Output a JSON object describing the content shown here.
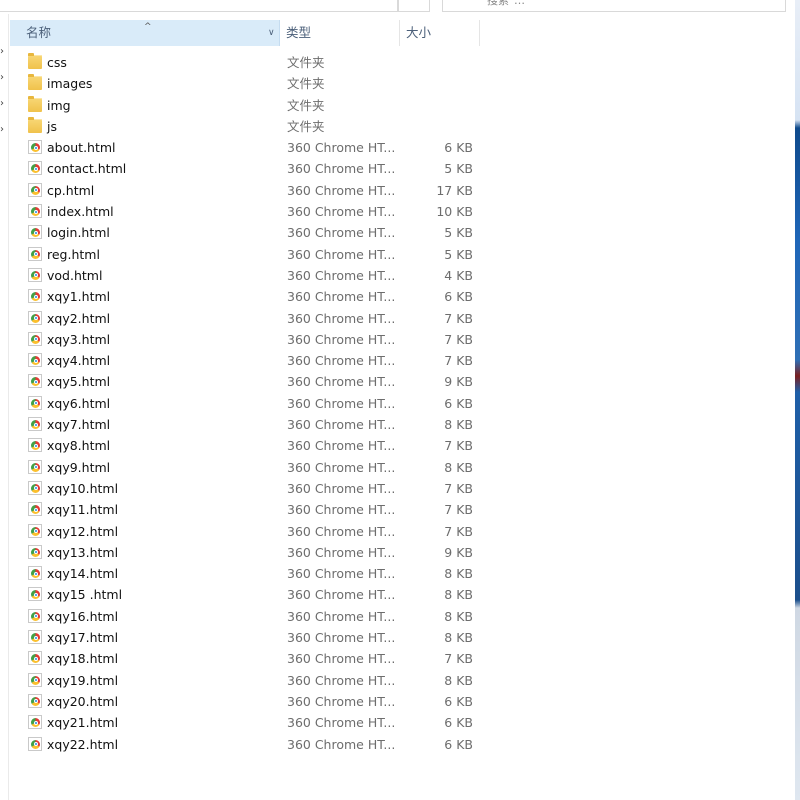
{
  "header": {
    "col_name": "名称",
    "col_type": "类型",
    "col_size": "大小",
    "sort_arrow": "^",
    "dropdown": "∨"
  },
  "topbar": {
    "breadcrumbs": [
      "…",
      "…",
      "…"
    ],
    "search_placeholder": "搜索\"…\""
  },
  "files": [
    {
      "name": "css",
      "type": "文件夹",
      "size": "",
      "icon": "folder-icon"
    },
    {
      "name": "images",
      "type": "文件夹",
      "size": "",
      "icon": "folder-icon"
    },
    {
      "name": "img",
      "type": "文件夹",
      "size": "",
      "icon": "folder-icon"
    },
    {
      "name": "js",
      "type": "文件夹",
      "size": "",
      "icon": "folder-icon"
    },
    {
      "name": "about.html",
      "type": "360 Chrome HT...",
      "size": "6 KB",
      "icon": "html-file-icon"
    },
    {
      "name": "contact.html",
      "type": "360 Chrome HT...",
      "size": "5 KB",
      "icon": "html-file-icon"
    },
    {
      "name": "cp.html",
      "type": "360 Chrome HT...",
      "size": "17 KB",
      "icon": "html-file-icon"
    },
    {
      "name": "index.html",
      "type": "360 Chrome HT...",
      "size": "10 KB",
      "icon": "html-file-icon"
    },
    {
      "name": "login.html",
      "type": "360 Chrome HT...",
      "size": "5 KB",
      "icon": "html-file-icon"
    },
    {
      "name": "reg.html",
      "type": "360 Chrome HT...",
      "size": "5 KB",
      "icon": "html-file-icon"
    },
    {
      "name": "vod.html",
      "type": "360 Chrome HT...",
      "size": "4 KB",
      "icon": "html-file-icon"
    },
    {
      "name": "xqy1.html",
      "type": "360 Chrome HT...",
      "size": "6 KB",
      "icon": "html-file-icon"
    },
    {
      "name": "xqy2.html",
      "type": "360 Chrome HT...",
      "size": "7 KB",
      "icon": "html-file-icon"
    },
    {
      "name": "xqy3.html",
      "type": "360 Chrome HT...",
      "size": "7 KB",
      "icon": "html-file-icon"
    },
    {
      "name": "xqy4.html",
      "type": "360 Chrome HT...",
      "size": "7 KB",
      "icon": "html-file-icon"
    },
    {
      "name": "xqy5.html",
      "type": "360 Chrome HT...",
      "size": "9 KB",
      "icon": "html-file-icon"
    },
    {
      "name": "xqy6.html",
      "type": "360 Chrome HT...",
      "size": "6 KB",
      "icon": "html-file-icon"
    },
    {
      "name": "xqy7.html",
      "type": "360 Chrome HT...",
      "size": "8 KB",
      "icon": "html-file-icon"
    },
    {
      "name": "xqy8.html",
      "type": "360 Chrome HT...",
      "size": "7 KB",
      "icon": "html-file-icon"
    },
    {
      "name": "xqy9.html",
      "type": "360 Chrome HT...",
      "size": "8 KB",
      "icon": "html-file-icon"
    },
    {
      "name": "xqy10.html",
      "type": "360 Chrome HT...",
      "size": "7 KB",
      "icon": "html-file-icon"
    },
    {
      "name": "xqy11.html",
      "type": "360 Chrome HT...",
      "size": "7 KB",
      "icon": "html-file-icon"
    },
    {
      "name": "xqy12.html",
      "type": "360 Chrome HT...",
      "size": "7 KB",
      "icon": "html-file-icon"
    },
    {
      "name": "xqy13.html",
      "type": "360 Chrome HT...",
      "size": "9 KB",
      "icon": "html-file-icon"
    },
    {
      "name": "xqy14.html",
      "type": "360 Chrome HT...",
      "size": "8 KB",
      "icon": "html-file-icon"
    },
    {
      "name": "xqy15 .html",
      "type": "360 Chrome HT...",
      "size": "8 KB",
      "icon": "html-file-icon"
    },
    {
      "name": "xqy16.html",
      "type": "360 Chrome HT...",
      "size": "8 KB",
      "icon": "html-file-icon"
    },
    {
      "name": "xqy17.html",
      "type": "360 Chrome HT...",
      "size": "8 KB",
      "icon": "html-file-icon"
    },
    {
      "name": "xqy18.html",
      "type": "360 Chrome HT...",
      "size": "7 KB",
      "icon": "html-file-icon"
    },
    {
      "name": "xqy19.html",
      "type": "360 Chrome HT...",
      "size": "8 KB",
      "icon": "html-file-icon"
    },
    {
      "name": "xqy20.html",
      "type": "360 Chrome HT...",
      "size": "6 KB",
      "icon": "html-file-icon"
    },
    {
      "name": "xqy21.html",
      "type": "360 Chrome HT...",
      "size": "6 KB",
      "icon": "html-file-icon"
    },
    {
      "name": "xqy22.html",
      "type": "360 Chrome HT...",
      "size": "6 KB",
      "icon": "html-file-icon"
    }
  ],
  "colors": {
    "header_selected_bg": "#d9ebf9",
    "header_text": "#4c607a",
    "folder": "#f0c24b",
    "secondary_text": "#6d6d6d"
  }
}
